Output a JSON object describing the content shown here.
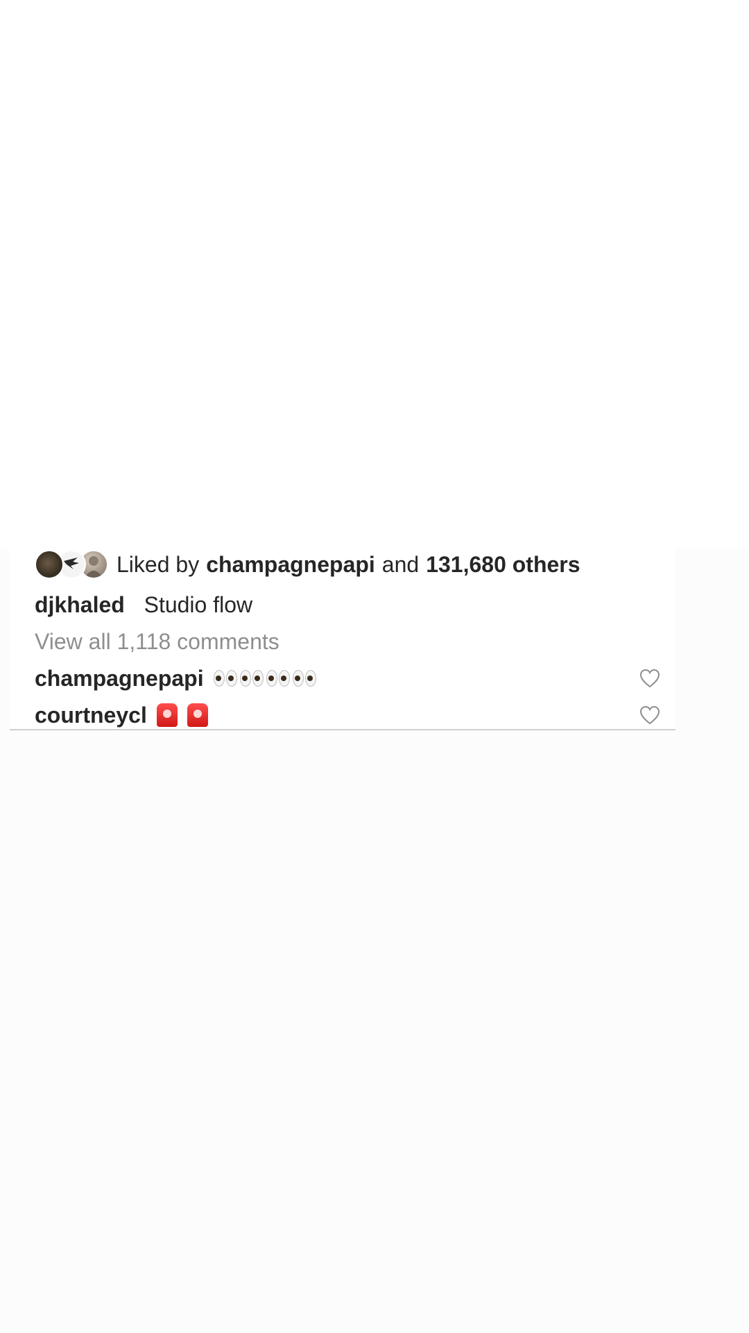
{
  "post": {
    "likes": {
      "prefix": "Liked by",
      "user": "champagnepapi",
      "conjunction": "and",
      "count": "131,680 others"
    },
    "caption": {
      "username": "djkhaled",
      "text": "Studio flow"
    },
    "view_all_comments": "View all 1,118 comments",
    "comments": [
      {
        "username": "champagnepapi",
        "emoji": "👀👀👀👀",
        "emoji_icon": "eyes-emoji"
      },
      {
        "username": "courtneycl",
        "emoji": "🚨🚨",
        "emoji_icon": "police-light-emoji"
      }
    ]
  },
  "icons": {
    "like": "heart-outline-icon"
  }
}
